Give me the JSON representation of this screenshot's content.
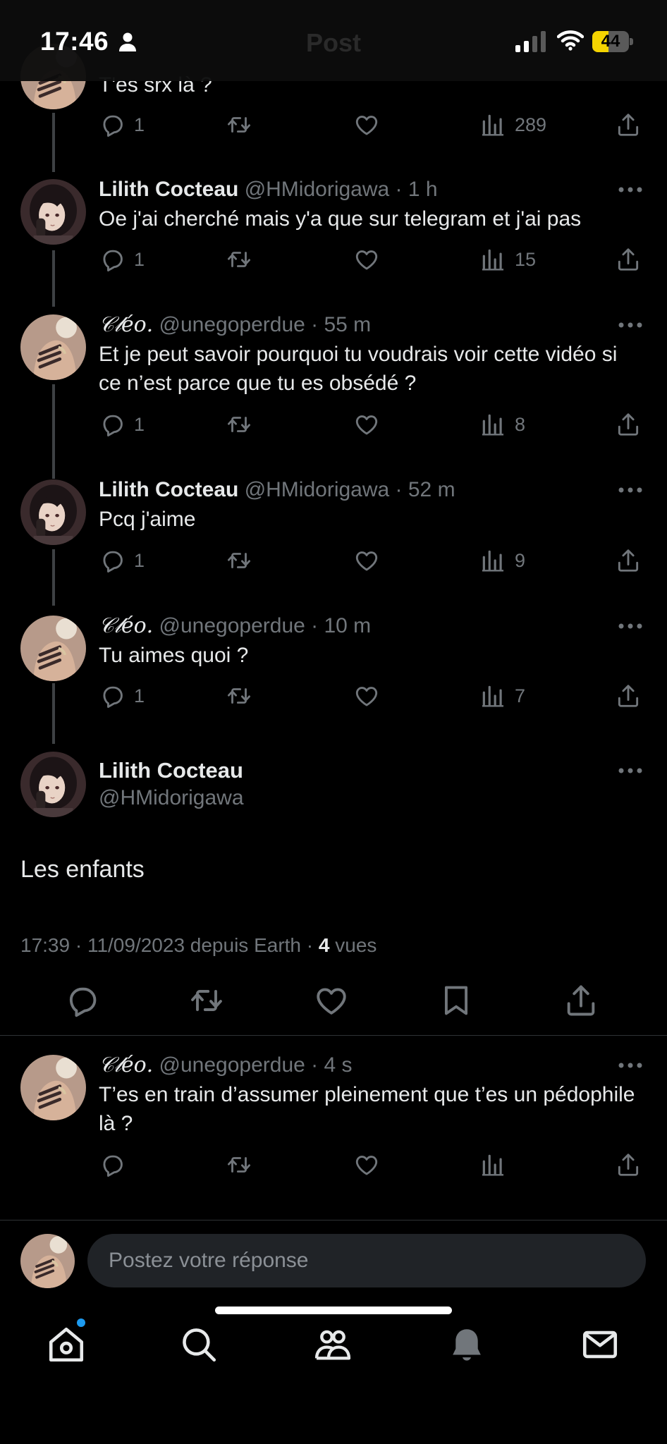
{
  "status_bar": {
    "time": "17:46",
    "battery": "44",
    "battery_level": 0.44,
    "header_title": "Post"
  },
  "colors": {
    "background": "#000000",
    "text": "#e7e9ea",
    "muted": "#71767b",
    "accent": "#1d9bf0",
    "battery": "#f5d400"
  },
  "icons": [
    "person-icon",
    "signal-icon",
    "wifi-icon",
    "battery-icon",
    "reply-icon",
    "retweet-icon",
    "like-icon",
    "views-icon",
    "share-icon",
    "bookmark-icon",
    "more-icon",
    "home-icon",
    "search-icon",
    "communities-icon",
    "notifications-icon",
    "messages-icon"
  ],
  "thread": [
    {
      "text": "T'es srx là ?",
      "replies": "1",
      "views": "289"
    },
    {
      "author": "Lilith Cocteau",
      "handle": "@HMidorigawa · 1 h",
      "text": "Oe j'ai cherché mais y'a que sur telegram et j'ai pas",
      "replies": "1",
      "views": "15"
    },
    {
      "author": "𝒞𝓁é𝑜.",
      "handle": "@unegoperdue · 55 m",
      "text": "Et je peut savoir pourquoi tu voudrais voir cette vidéo si ce n’est parce que tu es obsédé ?",
      "replies": "1",
      "views": "8"
    },
    {
      "author": "Lilith Cocteau",
      "handle": "@HMidorigawa · 52 m",
      "text": "Pcq j'aime",
      "replies": "1",
      "views": "9"
    },
    {
      "author": "𝒞𝓁é𝑜.",
      "handle": "@unegoperdue · 10 m",
      "text": "Tu aimes quoi ?",
      "replies": "1",
      "views": "7"
    }
  ],
  "main_tweet": {
    "author": "Lilith Cocteau",
    "handle": "@HMidorigawa",
    "text": "Les enfants",
    "meta": "17:39 · 11/09/2023 depuis Earth · ",
    "views_count": "4",
    "views_label": " vues"
  },
  "reply": {
    "author": "𝒞𝓁é𝑜.",
    "handle": "@unegoperdue · 4 s",
    "text": "T’es en train d’assumer pleinement que t’es un pédophile là ?"
  },
  "compose": {
    "placeholder": "Postez votre réponse"
  }
}
